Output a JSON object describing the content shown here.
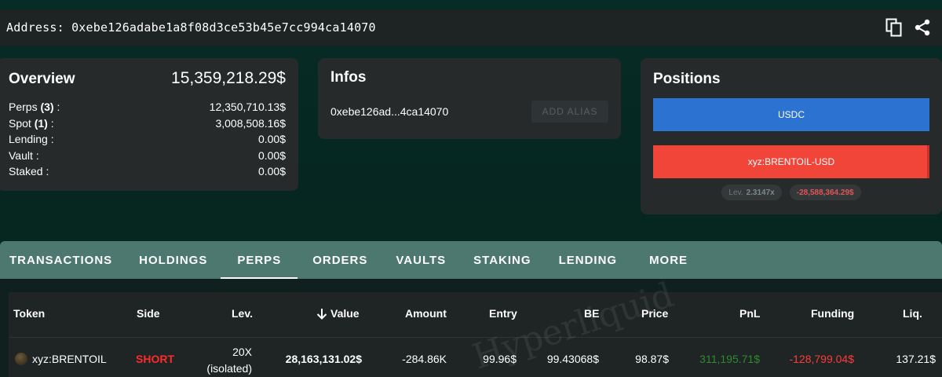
{
  "address_bar": {
    "label": "Address: 0xebe126adabe1a8f08d3ce53b45e7cc994ca14070",
    "icons": [
      "copy-icon",
      "share-icon"
    ]
  },
  "overview": {
    "title": "Overview",
    "total": "15,359,218.29$",
    "rows": [
      {
        "label_pre": "Perps ",
        "count": "(3)",
        "label_post": " :",
        "value": "12,350,710.13$"
      },
      {
        "label_pre": "Spot ",
        "count": "(1)",
        "label_post": " :",
        "value": "3,008,508.16$"
      },
      {
        "label_pre": "Lending :",
        "count": "",
        "label_post": "",
        "value": "0.00$"
      },
      {
        "label_pre": "Vault :",
        "count": "",
        "label_post": "",
        "value": "0.00$"
      },
      {
        "label_pre": "Staked :",
        "count": "",
        "label_post": "",
        "value": "0.00$"
      }
    ]
  },
  "infos": {
    "title": "Infos",
    "short_address": "0xebe126ad...4ca14070",
    "alias_button": "ADD ALIAS"
  },
  "positions": {
    "title": "Positions",
    "bars": [
      {
        "label": "USDC",
        "color": "#2b72d1"
      },
      {
        "label": "xyz:BRENTOIL-USD",
        "color": "#f2453a"
      }
    ],
    "lev_key": "Lev.",
    "lev_value": "2.3147x",
    "pnl_value": "-28,588,364.29$"
  },
  "tabs": [
    {
      "label": "TRANSACTIONS",
      "active": false
    },
    {
      "label": "HOLDINGS",
      "active": false
    },
    {
      "label": "PERPS",
      "active": true
    },
    {
      "label": "ORDERS",
      "active": false
    },
    {
      "label": "VAULTS",
      "active": false
    },
    {
      "label": "STAKING",
      "active": false
    },
    {
      "label": "LENDING",
      "active": false
    },
    {
      "label": "MORE",
      "active": false
    }
  ],
  "table": {
    "columns": [
      "Token",
      "Side",
      "Lev.",
      "Value",
      "Amount",
      "Entry",
      "BE",
      "Price",
      "PnL",
      "Funding",
      "Liq."
    ],
    "sort_icon": "arrow-down-icon",
    "watermark": "Hyperliquid",
    "rows": [
      {
        "token": "xyz:BRENTOIL",
        "side": "SHORT",
        "lev_line1": "20X",
        "lev_line2": "(isolated)",
        "value": "28,163,131.02$",
        "amount": "-284.86K",
        "entry": "99.96$",
        "be": "99.43068$",
        "price": "98.87$",
        "pnl": "311,195.71$",
        "funding": "-128,799.04$",
        "liq": "137.21$"
      }
    ]
  },
  "colors": {
    "short": "#ff2b2b",
    "pnl_positive": "#2e8b2e",
    "funding_negative": "#ff3b3b",
    "tab_bar": "#4c786f"
  }
}
